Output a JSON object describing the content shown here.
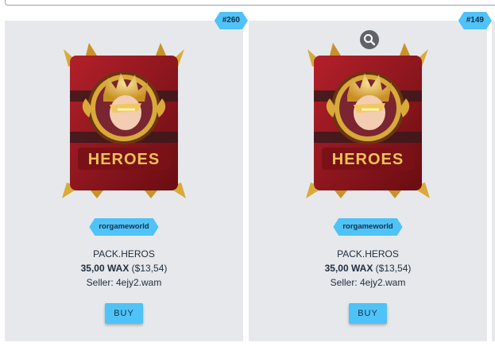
{
  "cards": [
    {
      "mint_badge": "#260",
      "collection": "rorgameworld",
      "name": "PACK.HEROS",
      "price_wax": "35,00 WAX",
      "price_usd": "($13,54)",
      "seller": "Seller: 4ejy2.wam",
      "buy_label": "BUY",
      "art_text": "HEROES",
      "has_zoom": false
    },
    {
      "mint_badge": "#149",
      "collection": "rorgameworld",
      "name": "PACK.HEROS",
      "price_wax": "35,00 WAX",
      "price_usd": "($13,54)",
      "seller": "Seller: 4ejy2.wam",
      "buy_label": "BUY",
      "art_text": "HEROES",
      "has_zoom": true
    }
  ],
  "colors": {
    "accent": "#4fc3f7",
    "card_bg": "#e6e8eb",
    "text": "#1f2d3d",
    "pack_red": "#8f1419",
    "gold": "#d9a93a"
  },
  "icons": {
    "zoom": "magnifier-icon"
  }
}
